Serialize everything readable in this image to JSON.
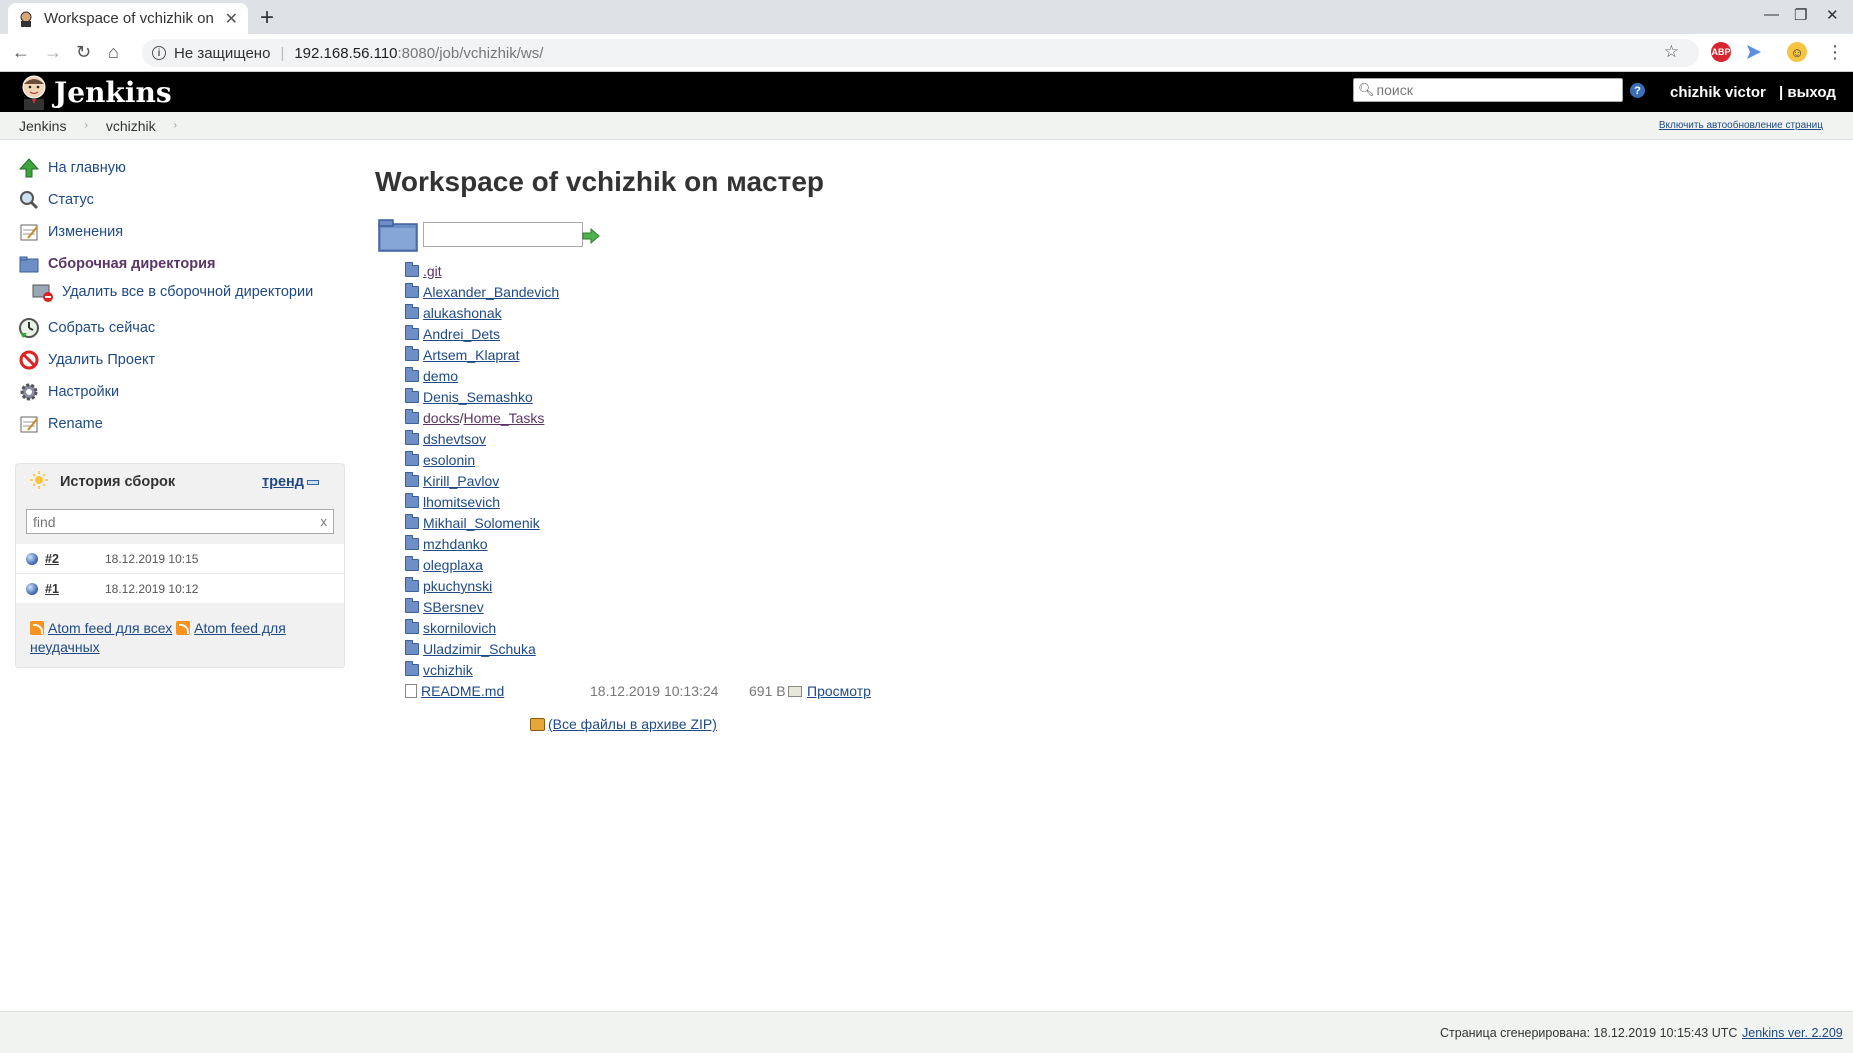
{
  "browser": {
    "tab_title": "Workspace of vchizhik on",
    "new_tab": "+",
    "insecure_label": "Не защищено",
    "url_host": "192.168.56.110",
    "url_path": ":8080/job/vchizhik/ws/",
    "ext_abp": "ABP"
  },
  "header": {
    "logo_text": "Jenkins",
    "search_placeholder": "поиск",
    "help": "?",
    "user": "chizhik victor",
    "logout": "| выход"
  },
  "breadcrumb": {
    "items": [
      "Jenkins",
      "vchizhik"
    ],
    "autorefresh": "Включить автообновление страниц"
  },
  "sidebar": {
    "tasks": [
      {
        "label": "На главную",
        "icon": "up-arrow-icon"
      },
      {
        "label": "Статус",
        "icon": "magnifier-icon"
      },
      {
        "label": "Изменения",
        "icon": "notepad-icon"
      },
      {
        "label": "Сборочная директория",
        "icon": "folder-icon"
      },
      {
        "label": "Удалить все в сборочной директории",
        "icon": "delete-folder-icon"
      },
      {
        "label": "Собрать сейчас",
        "icon": "build-clock-icon"
      },
      {
        "label": "Удалить Проект",
        "icon": "no-entry-icon"
      },
      {
        "label": "Настройки",
        "icon": "gear-icon"
      },
      {
        "label": "Rename",
        "icon": "notepad-icon"
      }
    ]
  },
  "history": {
    "title": "История сборок",
    "trend": "тренд",
    "find_placeholder": "find",
    "find_clear": "x",
    "builds": [
      {
        "number": "#2",
        "date": "18.12.2019 10:15"
      },
      {
        "number": "#1",
        "date": "18.12.2019 10:12"
      }
    ],
    "feed_all": "Atom feed для всех",
    "feed_failed": "Atom feed для неудачных"
  },
  "main": {
    "title": "Workspace of vchizhik on мастер",
    "folders": [
      ".git",
      "Alexander_Bandevich",
      "alukashonak",
      "Andrei_Dets",
      "Artsem_Klaprat",
      "demo",
      "Denis_Semashko",
      "docks",
      "dshevtsov",
      "esolonin",
      "Kirill_Pavlov",
      "lhomitsevich",
      "Mikhail_Solomenik",
      "mzhdanko",
      "olegplaxa",
      "pkuchynski",
      "SBersnev",
      "skornilovich",
      "Uladzimir_Schuka",
      "vchizhik"
    ],
    "docks_sub": "Home_Tasks",
    "file": {
      "name": "README.md",
      "date": "18.12.2019 10:13:24",
      "size": "691 B",
      "view": "Просмотр"
    },
    "zip_link": "(Все файлы в архиве ZIP)"
  },
  "footer": {
    "generated": "Страница сгенерирована: 18.12.2019 10:15:43 UTC",
    "version": "Jenkins ver. 2.209"
  }
}
